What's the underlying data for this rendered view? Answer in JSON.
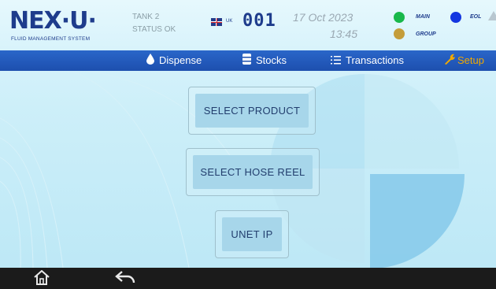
{
  "header": {
    "logo": "NEX·U·",
    "logo_subtitle": "FLUID MANAGEMENT SYSTEM",
    "tank_name": "TANK 2",
    "tank_status": "STATUS OK",
    "language": "UK",
    "counter": "001",
    "date": "17 Oct 2023",
    "time": "13:45",
    "indicators": {
      "main_label": "MAIN",
      "main_color": "#18b84a",
      "eol_label": "EOL",
      "eol_color": "#1436e0",
      "group_label": "GROUP",
      "group_color": "#c49d3a"
    }
  },
  "nav": {
    "items": [
      {
        "label": "Dispense",
        "icon": "drop-icon"
      },
      {
        "label": "Stocks",
        "icon": "barrel-icon"
      },
      {
        "label": "Transactions",
        "icon": "list-icon"
      },
      {
        "label": "Setup",
        "icon": "wrench-icon"
      }
    ],
    "active_color": "#f0a800"
  },
  "main": {
    "buttons": {
      "select_product": "SELECT PRODUCT",
      "select_hose_reel": "SELECT HOSE REEL",
      "unet_ip": "UNET IP"
    }
  },
  "softkeys": {
    "icons": [
      "home-icon",
      "back-icon"
    ]
  }
}
